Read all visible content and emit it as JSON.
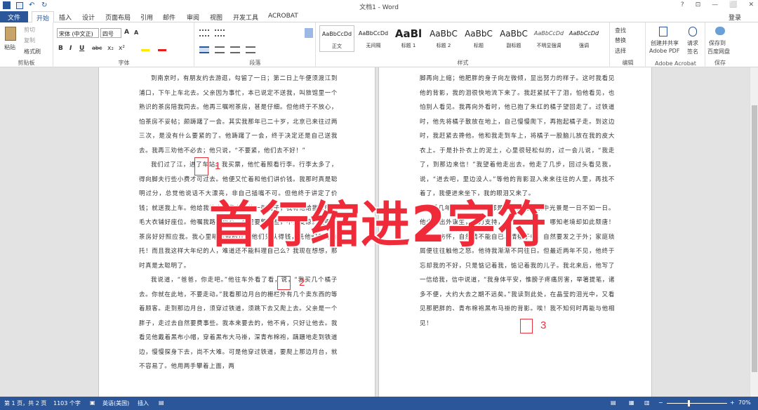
{
  "title": "文档1 - Word",
  "window": {
    "help": "?",
    "restore": "⬜",
    "minimize": "—",
    "close": "✕"
  },
  "tabs": [
    "开始",
    "插入",
    "设计",
    "页面布局",
    "引用",
    "邮件",
    "审阅",
    "视图",
    "开发工具",
    "ACROBAT"
  ],
  "file_tab": "文件",
  "login": "登录",
  "clipboard": {
    "paste": "粘贴",
    "cut": "剪切",
    "copy": "复制",
    "painter": "格式刷",
    "label": "剪贴板"
  },
  "font": {
    "name": "宋体 (中文正)",
    "size": "四号",
    "label": "字体",
    "grow": "A",
    "shrink": "A",
    "bold": "B",
    "italic": "I",
    "underline": "U",
    "strike": "abc",
    "sub": "x₂",
    "sup": "x²"
  },
  "paragraph": {
    "label": "段落"
  },
  "styles": {
    "label": "样式",
    "items": [
      {
        "prev": "AaBbCcDd",
        "name": "正文"
      },
      {
        "prev": "AaBbCcDd",
        "name": "无间隔"
      },
      {
        "prev": "AaBl",
        "name": "标题 1"
      },
      {
        "prev": "AaBbC",
        "name": "标题 2"
      },
      {
        "prev": "AaBbC",
        "name": "标题"
      },
      {
        "prev": "AaBbC",
        "name": "副标题"
      },
      {
        "prev": "AaBbCcDd",
        "name": "不明显强调"
      },
      {
        "prev": "AaBbCcDd",
        "name": "强调"
      }
    ]
  },
  "editing": {
    "find": "查找",
    "replace": "替换",
    "select": "选择",
    "label": "编辑"
  },
  "acrobat": {
    "create": "创建并共享",
    "pdf": "Adobe PDF",
    "request": "请求",
    "sign": "签名",
    "label": "Adobe Acrobat"
  },
  "save": {
    "line1": "保存到",
    "line2": "百度网盘",
    "label": "保存"
  },
  "left_paras": [
    "到南京时，有朋友约去游逛，勾留了一日；第二日上午便须渡江到浦口，下午上车北去。父亲因为事忙，本已说定不送我，叫旅馆里一个熟识的茶房陪我同去。他再三嘱咐茶房，甚是仔细。但他终于不放心，怕茶房不妥帖；颇踌躇了一会。其实我那年已二十岁，北京已来往过两三次，是没有什么要紧的了。他踌躇了一会，终于决定还是自己送我去。我再三劝他不必去；他只说，“不要紧，他们去不好！”",
    "我们过了江，进了车站。我买票，他忙着照看行李。行李太多了，得向脚夫行些小费才可过去。他便又忙着和他们讲价钱。我那时真是聪明过分，总觉他说话不大漂亮，非自己插嘴不可。但他终于讲定了价钱；就送我上车。他给我拣定了靠车门的一张椅子；我将他给我做的紫毛大衣铺好座位。他嘱我路上小心，夜里要警醒些，不要受凉。又嘱托茶房好好照应我。我心里暗笑他的迂；他们只认得钱，托他们只是白托！而且我这样大年纪的人，难道还不能料理自己么？我现在想想，那时真是太聪明了。",
    "我说道，“爸爸，你走吧。”他往车外看了看，说，“我买几个橘子去。你就在此地，不要走动。”我看那边月台的栅栏外有几个卖东西的等着顾客。走到那边月台，须穿过铁道，须跳下去又爬上去。父亲是一个胖子，走过去自然要费事些。我本来要去的，他不肯，只好让他去。我看见他戴着黑布小帽，穿着黑布大马褂，深青布棉袍，蹒跚地走到铁道边，慢慢探身下去，尚不大难。可是他穿过铁道，要爬上那边月台，就不容易了。他用两手攀着上面，两"
  ],
  "right_paras": [
    "脚再向上缩；他肥胖的身子向左微倾，显出努力的样子。这时我看见他的背影，我的泪很快地流下来了。我赶紧拭干了泪，怕他看见，也怕别人看见。我再向外看时，他已抱了朱红的橘子望回走了。过铁道时，他先将橘子散放在地上，自己慢慢爬下，再抱起橘子走。到这边时，我赶紧去搀他。他和我走到车上，将橘子一股脑儿放在我的皮大衣上。于是扑扑衣上的泥土，心里很轻松似的，过一会儿说，“我走了，到那边来信！”我望着他走出去。他走了几步，回过头看见我，说，“进去吧，里边没人。”等他的背影混入来来往往的人里，再找不着了，我便进来坐下，我的眼泪又来了。",
    "近几年来，父亲和我都是东奔西走，家中光景是一日不如一日。他少年出外谋生，独力支持，做了许多大事。哪知老境却如此颓唐！他触目伤怀，自然情不能自已。情郁于中，自然要发之于外；家庭琐屑便往往触他之怒。他待我渐渐不同往日。但最近两年不见，他终于忘却我的不好，只是惦记着我，惦记着我的儿子。我北来后，他写了一信给我，信中说道，“我身体平安，惟膀子疼痛厉害，举箸提笔，诸多不便，大约大去之期不远矣。”我读到此处，在晶莹的泪光中，又看见那肥胖的、青布棉袍黑布马褂的背影。唉！我不知何时再能与他相见！"
  ],
  "overlay": "首行缩进2字符",
  "marks": [
    "1",
    "2",
    "3"
  ],
  "status": {
    "page": "第 1 页，共 2 页",
    "words": "1103 个字",
    "lang": "英语(美国)",
    "mode": "插入",
    "zoom": "70%"
  }
}
